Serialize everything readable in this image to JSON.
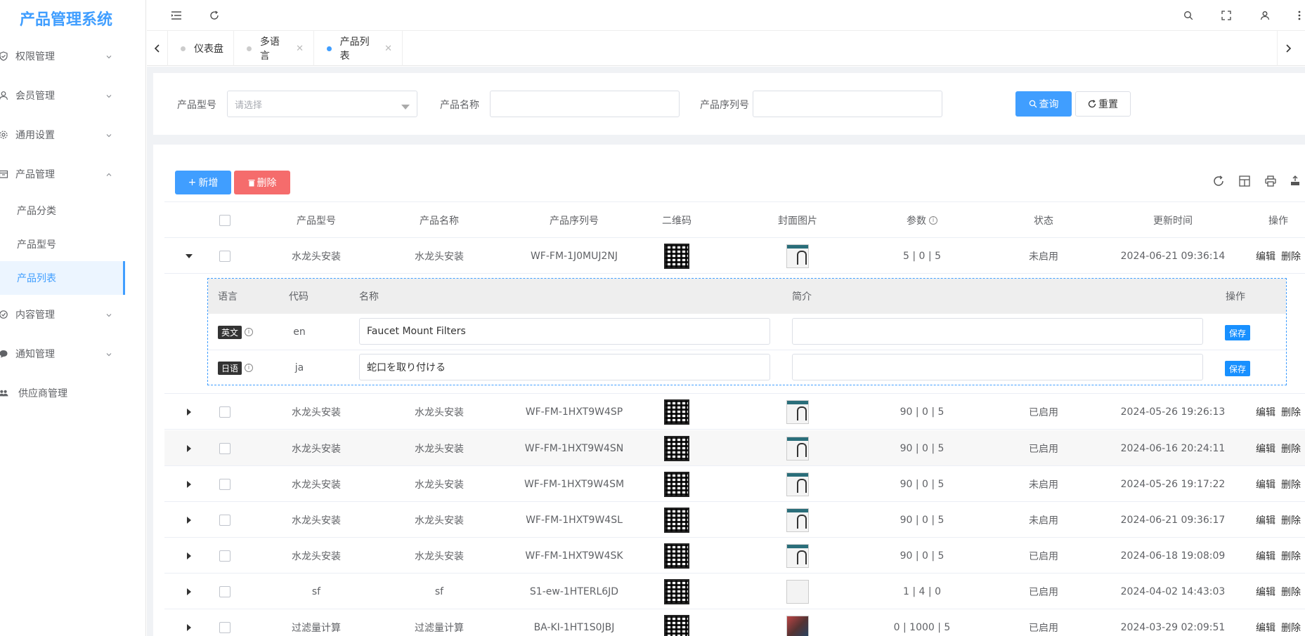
{
  "app": {
    "title": "产品管理系统"
  },
  "sidebar": {
    "items": [
      {
        "label": "权限管理"
      },
      {
        "label": "会员管理"
      },
      {
        "label": "通用设置"
      },
      {
        "label": "产品管理"
      },
      {
        "label": "内容管理"
      },
      {
        "label": "通知管理"
      },
      {
        "label": "供应商管理"
      }
    ],
    "sub_items": [
      {
        "label": "产品分类"
      },
      {
        "label": "产品型号"
      },
      {
        "label": "产品列表"
      }
    ]
  },
  "tabs": [
    {
      "label": "仪表盘"
    },
    {
      "label": "多语言"
    },
    {
      "label": "产品列表"
    }
  ],
  "search": {
    "model_label": "产品型号",
    "model_placeholder": "请选择",
    "name_label": "产品名称",
    "name_value": "",
    "serial_label": "产品序列号",
    "serial_value": "",
    "query_label": "查询",
    "reset_label": "重置"
  },
  "toolbar": {
    "add_label": "新增",
    "delete_label": "删除"
  },
  "table": {
    "columns": [
      "产品型号",
      "产品名称",
      "产品序列号",
      "二维码",
      "封面图片",
      "参数",
      "状态",
      "更新时间",
      "操作"
    ],
    "edit_label": "编辑",
    "delete_label": "删除",
    "rows": [
      {
        "model": "水龙头安装",
        "name": "水龙头安装",
        "serial": "WF-FM-1J0MUJ2NJ",
        "params": "5 | 0 | 5",
        "status": "未启用",
        "updated": "2024-06-21 09:36:14"
      },
      {
        "model": "水龙头安装",
        "name": "水龙头安装",
        "serial": "WF-FM-1HXT9W4SP",
        "params": "90 | 0 | 5",
        "status": "已启用",
        "updated": "2024-05-26 19:26:13"
      },
      {
        "model": "水龙头安装",
        "name": "水龙头安装",
        "serial": "WF-FM-1HXT9W4SN",
        "params": "90 | 0 | 5",
        "status": "已启用",
        "updated": "2024-06-16 20:24:11"
      },
      {
        "model": "水龙头安装",
        "name": "水龙头安装",
        "serial": "WF-FM-1HXT9W4SM",
        "params": "90 | 0 | 5",
        "status": "未启用",
        "updated": "2024-05-26 19:17:22"
      },
      {
        "model": "水龙头安装",
        "name": "水龙头安装",
        "serial": "WF-FM-1HXT9W4SL",
        "params": "90 | 0 | 5",
        "status": "未启用",
        "updated": "2024-06-21 09:36:17"
      },
      {
        "model": "水龙头安装",
        "name": "水龙头安装",
        "serial": "WF-FM-1HXT9W4SK",
        "params": "90 | 0 | 5",
        "status": "已启用",
        "updated": "2024-06-18 19:08:09"
      },
      {
        "model": "sf",
        "name": "sf",
        "serial": "S1-ew-1HTERL6JD",
        "params": "1 | 4 | 0",
        "status": "已启用",
        "updated": "2024-04-02 14:43:03"
      },
      {
        "model": "过滤量计算",
        "name": "过滤量计算",
        "serial": "BA-KI-1HT1S0JBJ",
        "params": "0 | 1000 | 5",
        "status": "已启用",
        "updated": "2024-03-29 02:09:51"
      }
    ]
  },
  "expanded": {
    "columns": [
      "语言",
      "代码",
      "名称",
      "简介",
      "操作"
    ],
    "save_label": "保存",
    "rows": [
      {
        "lang": "英文",
        "code": "en",
        "name": "Faucet Mount Filters",
        "intro": ""
      },
      {
        "lang": "日语",
        "code": "ja",
        "name": "蛇口を取り付ける",
        "intro": ""
      }
    ]
  }
}
